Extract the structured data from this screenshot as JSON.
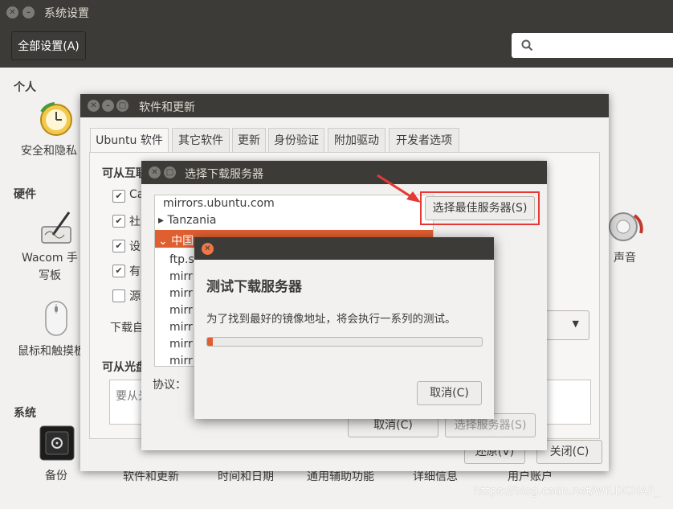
{
  "main_window": {
    "title": "系统设置",
    "all_settings_label": "全部设置(A)",
    "search_placeholder": "",
    "sections": {
      "personal": "个人",
      "hardware": "硬件",
      "system": "系统"
    },
    "items": {
      "security": "安全和隐私",
      "wacom": "Wacom 手写板",
      "mouse": "鼠标和触摸板",
      "sound": "声音",
      "backup": "备份",
      "software": "软件和更新",
      "datetime": "时间和日期",
      "accessibility": "通用辅助功能",
      "details": "详细信息",
      "users": "用户账户"
    }
  },
  "software_window": {
    "title": "软件和更新",
    "tabs": [
      "Ubuntu 软件",
      "其它软件",
      "更新",
      "身份验证",
      "附加驱动",
      "开发者选项"
    ],
    "internet_heading": "可从互联网下载",
    "checkboxes": [
      {
        "label": "Ca",
        "checked": true
      },
      {
        "label": "社",
        "checked": true
      },
      {
        "label": "设",
        "checked": true
      },
      {
        "label": "有",
        "checked": true
      },
      {
        "label": "源",
        "checked": false
      }
    ],
    "download_from_label": "下载自",
    "cdrom_heading": "可从光盘",
    "cdrom_placeholder": "要从光",
    "protocol_label": "协议：",
    "revert_button": "还原(V)",
    "close_button": "关闭(C)"
  },
  "select_window": {
    "title": "选择下载服务器",
    "mirrors": [
      {
        "label": "mirrors.ubuntu.com",
        "selected": false
      },
      {
        "label": "▸ Tanzania",
        "selected": false
      },
      {
        "label": "⌄ 中国",
        "selected": true
      },
      {
        "label": "ftp.s",
        "selected": false
      },
      {
        "label": "mirr",
        "selected": false
      },
      {
        "label": "mirr",
        "selected": false
      },
      {
        "label": "mirr",
        "selected": false
      },
      {
        "label": "mirr",
        "selected": false
      },
      {
        "label": "mirr",
        "selected": false
      },
      {
        "label": "mirr",
        "selected": false
      }
    ],
    "best_server_button": "选择最佳服务器(S)",
    "cancel_button": "取消(C)",
    "select_button": "选择服务器(S)"
  },
  "test_dialog": {
    "heading": "测试下载服务器",
    "message": "为了找到最好的镜像地址，将会执行一系列的测试。",
    "progress": 0.02,
    "cancel_button": "取消(C)"
  },
  "watermark": "https://blog.csdn.net/WILDCHAP_",
  "colors": {
    "titlebar": "#3c3b37",
    "selection": "#e05f30",
    "highlight_box": "#e53935",
    "close_button": "#f07746"
  }
}
